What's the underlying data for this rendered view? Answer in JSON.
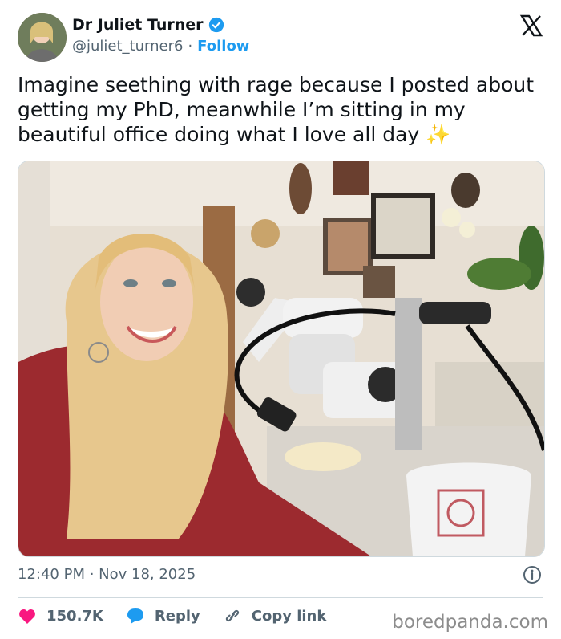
{
  "author": {
    "name": "Dr Juliet Turner",
    "handle": "@juliet_turner6",
    "separator": "·",
    "follow_label": "Follow"
  },
  "tweet": {
    "text": "Imagine seething with rage because I posted about getting my PhD, meanwhile I’m sitting in my beautiful office doing what I love all day",
    "emoji": "✨"
  },
  "meta": {
    "timestamp": "12:40 PM · Nov 18, 2025"
  },
  "actions": {
    "likes": "150.7K",
    "reply_label": "Reply",
    "copy_link_label": "Copy link"
  },
  "watermark": "boredpanda.com",
  "colors": {
    "accent": "#1d9bf0",
    "like": "#f91880",
    "text": "#0f1419",
    "muted": "#536471"
  }
}
